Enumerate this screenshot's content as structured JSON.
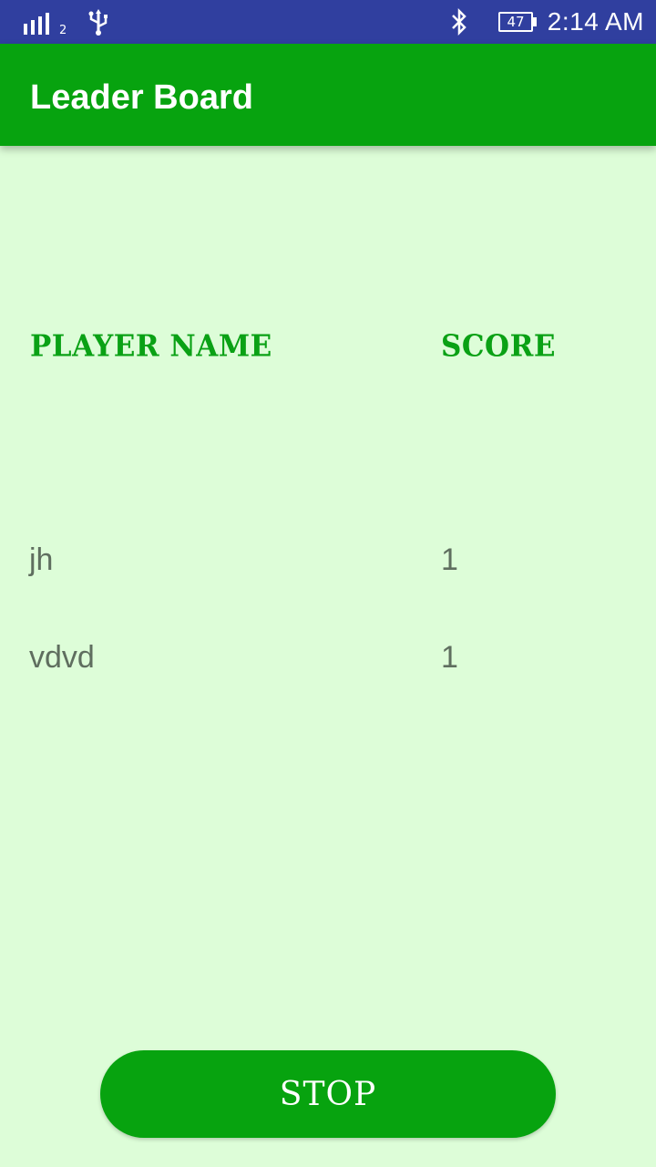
{
  "status_bar": {
    "sim_slot": "2",
    "battery_level": "47",
    "time": "2:14 AM",
    "icons": [
      "signal-icon",
      "usb-icon",
      "bluetooth-icon",
      "battery-icon"
    ]
  },
  "app_bar": {
    "title": "Leader Board"
  },
  "table": {
    "headers": {
      "name": "PLAYER NAME",
      "score": "SCORE"
    },
    "rows": [
      {
        "name": "jh",
        "score": "1"
      },
      {
        "name": "vdvd",
        "score": "1"
      }
    ]
  },
  "stop_button": {
    "label": "STOP"
  },
  "colors": {
    "status_bar": "#303f9f",
    "app_bar": "#07a30f",
    "background": "#ddfdd8",
    "header_text": "#0aa115",
    "row_text": "#5f6e5f"
  }
}
